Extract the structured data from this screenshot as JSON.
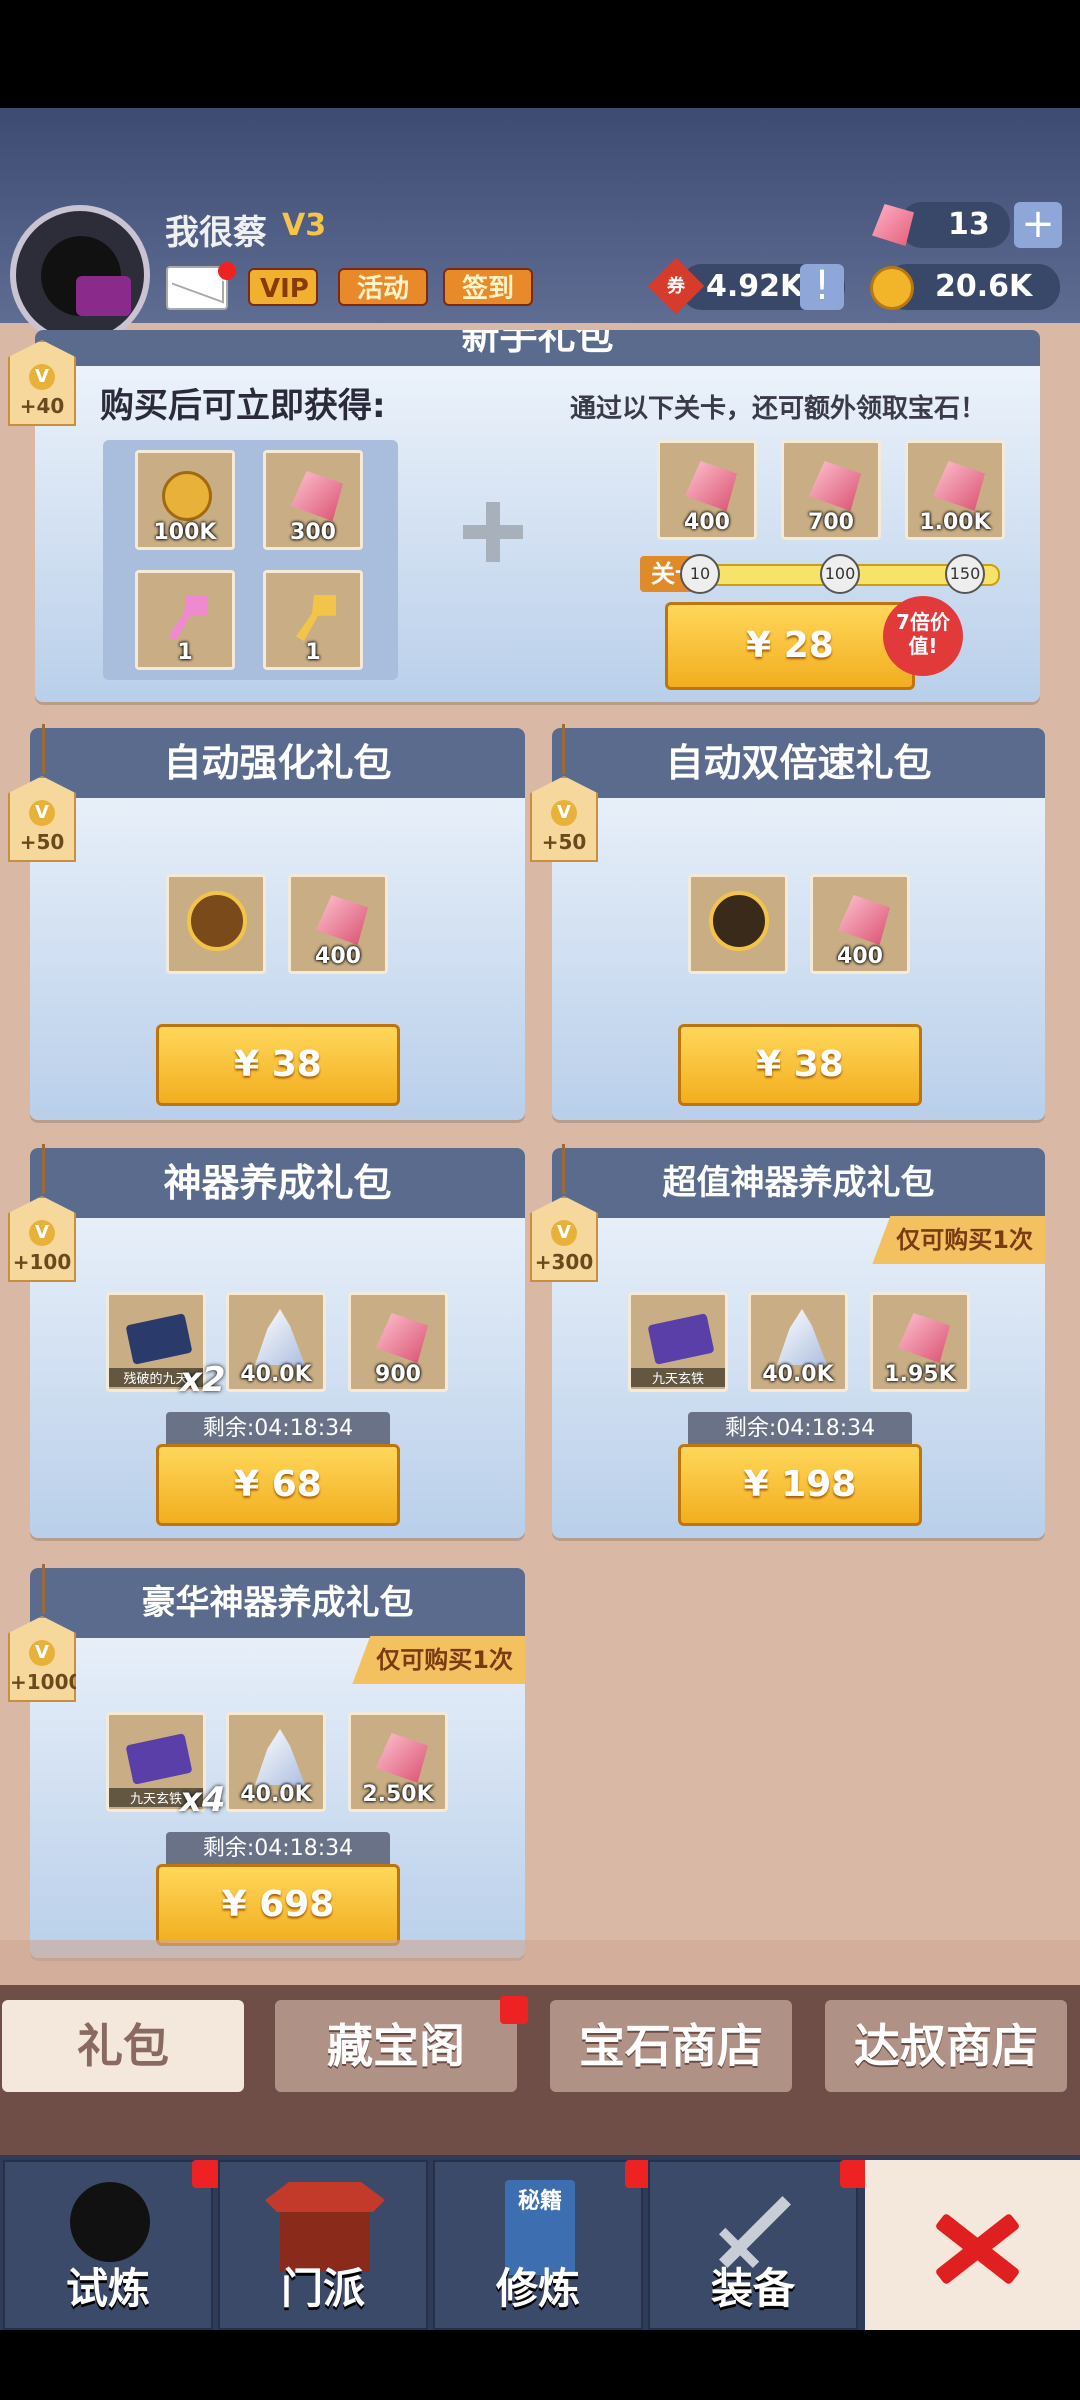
{
  "player": {
    "name": "我很蔡",
    "vip_level": "V3"
  },
  "hud": {
    "vip_label": "VIP",
    "activity_label": "活动",
    "signin_label": "签到",
    "gems": "13",
    "plus": "+",
    "tickets": "4.92K",
    "coins": "20.6K",
    "ticket_icon_text": "券",
    "info_mark": "!"
  },
  "newbie": {
    "title": "新手礼包",
    "vip_points": "+40",
    "left_caption": "购买后可立即获得:",
    "right_caption": "通过以下关卡，还可额外领取宝石！",
    "items": [
      "100K",
      "300",
      "1",
      "1"
    ],
    "bonus": [
      "400",
      "700",
      "1.00K"
    ],
    "stage_label": "关卡",
    "stages": [
      "10",
      "100",
      "150"
    ],
    "price": "¥ 28",
    "badge": "7倍价值!"
  },
  "packs": [
    {
      "title": "自动强化礼包",
      "vip": "+50",
      "items": [
        "",
        "400"
      ],
      "price": "¥ 38"
    },
    {
      "title": "自动双倍速礼包",
      "vip": "+50",
      "items": [
        "",
        "400"
      ],
      "price": "¥ 38"
    },
    {
      "title": "神器养成礼包",
      "vip": "+100",
      "item1_label": "残破的九天",
      "items": [
        "x2",
        "40.0K",
        "900"
      ],
      "timer": "剩余:04:18:34",
      "price": "¥ 68"
    },
    {
      "title": "超值神器养成礼包",
      "vip": "+300",
      "item1_label": "九天玄铁",
      "items": [
        "",
        "40.0K",
        "1.95K"
      ],
      "once": "仅可购买1次",
      "timer": "剩余:04:18:34",
      "price": "¥ 198"
    },
    {
      "title": "豪华神器养成礼包",
      "vip": "+1000",
      "item1_label": "九天玄铁",
      "items": [
        "x4",
        "40.0K",
        "2.50K"
      ],
      "once": "仅可购买1次",
      "timer": "剩余:04:18:34",
      "price": "¥ 698"
    }
  ],
  "shop_tabs": [
    "礼包",
    "藏宝阁",
    "宝石商店",
    "达叔商店"
  ],
  "nav": [
    "试炼",
    "门派",
    "修炼",
    "装备"
  ],
  "book_label": "秘籍",
  "colors": {
    "accent": "#f2ae1f",
    "header": "#5a6b8e",
    "close": "#e02020"
  }
}
